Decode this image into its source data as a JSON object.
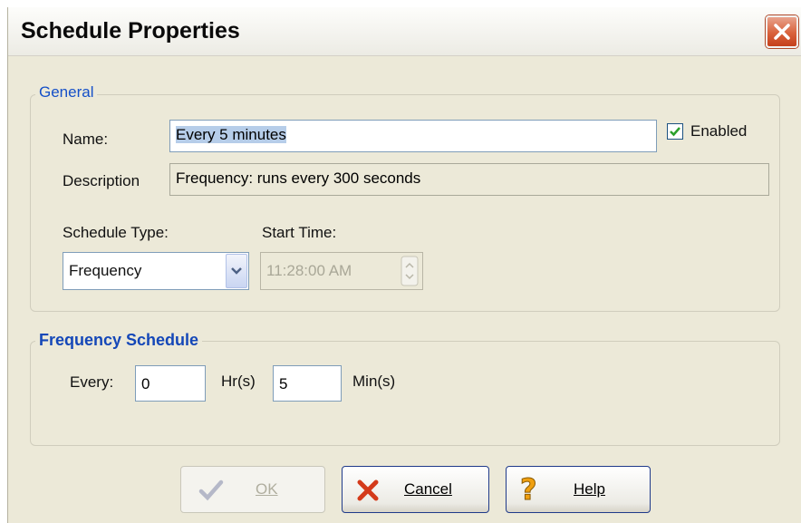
{
  "dialog": {
    "title": "Schedule Properties",
    "close_icon": "close-icon"
  },
  "general": {
    "legend": "General",
    "name_label": "Name:",
    "name_value": "Every 5 minutes",
    "enabled_label": "Enabled",
    "enabled_checked": true,
    "description_label": "Description",
    "description_value": "Frequency:  runs every 300 seconds",
    "schedule_type_label": "Schedule Type:",
    "schedule_type_value": "Frequency",
    "start_time_label": "Start Time:",
    "start_time_value": "11:28:00 AM"
  },
  "frequency": {
    "legend": "Frequency Schedule",
    "every_label": "Every:",
    "hours_value": "0",
    "hours_label": "Hr(s)",
    "minutes_value": "5",
    "minutes_label": "Min(s)"
  },
  "buttons": {
    "ok_label": "OK",
    "cancel_label": "Cancel",
    "help_label": "Help"
  },
  "colors": {
    "legend_blue": "#1550c8",
    "check_green": "#2ba02b",
    "cancel_red": "#d43a1a",
    "help_orange": "#f0a010"
  }
}
